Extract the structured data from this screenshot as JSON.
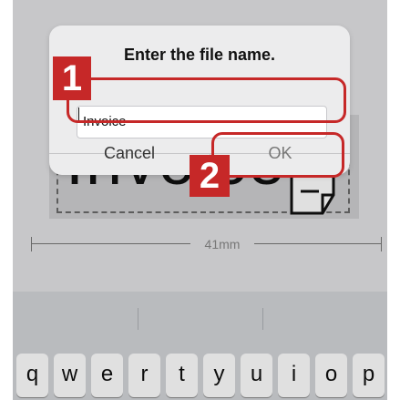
{
  "label": {
    "preview_text": "Invoice",
    "width_text": "41mm"
  },
  "dialog": {
    "title": "Enter the file name.",
    "input_value": "Invoice",
    "cancel_label": "Cancel",
    "ok_label": "OK"
  },
  "callouts": [
    {
      "number": "1"
    },
    {
      "number": "2"
    }
  ],
  "keyboard": {
    "row1": [
      "q",
      "w",
      "e",
      "r",
      "t",
      "y",
      "u",
      "i",
      "o",
      "p"
    ]
  },
  "colors": {
    "highlight": "#c62828",
    "dialog_bg": "#ececed",
    "screen_bg": "#d1d1d3"
  },
  "icons": {
    "document": "document-icon"
  }
}
